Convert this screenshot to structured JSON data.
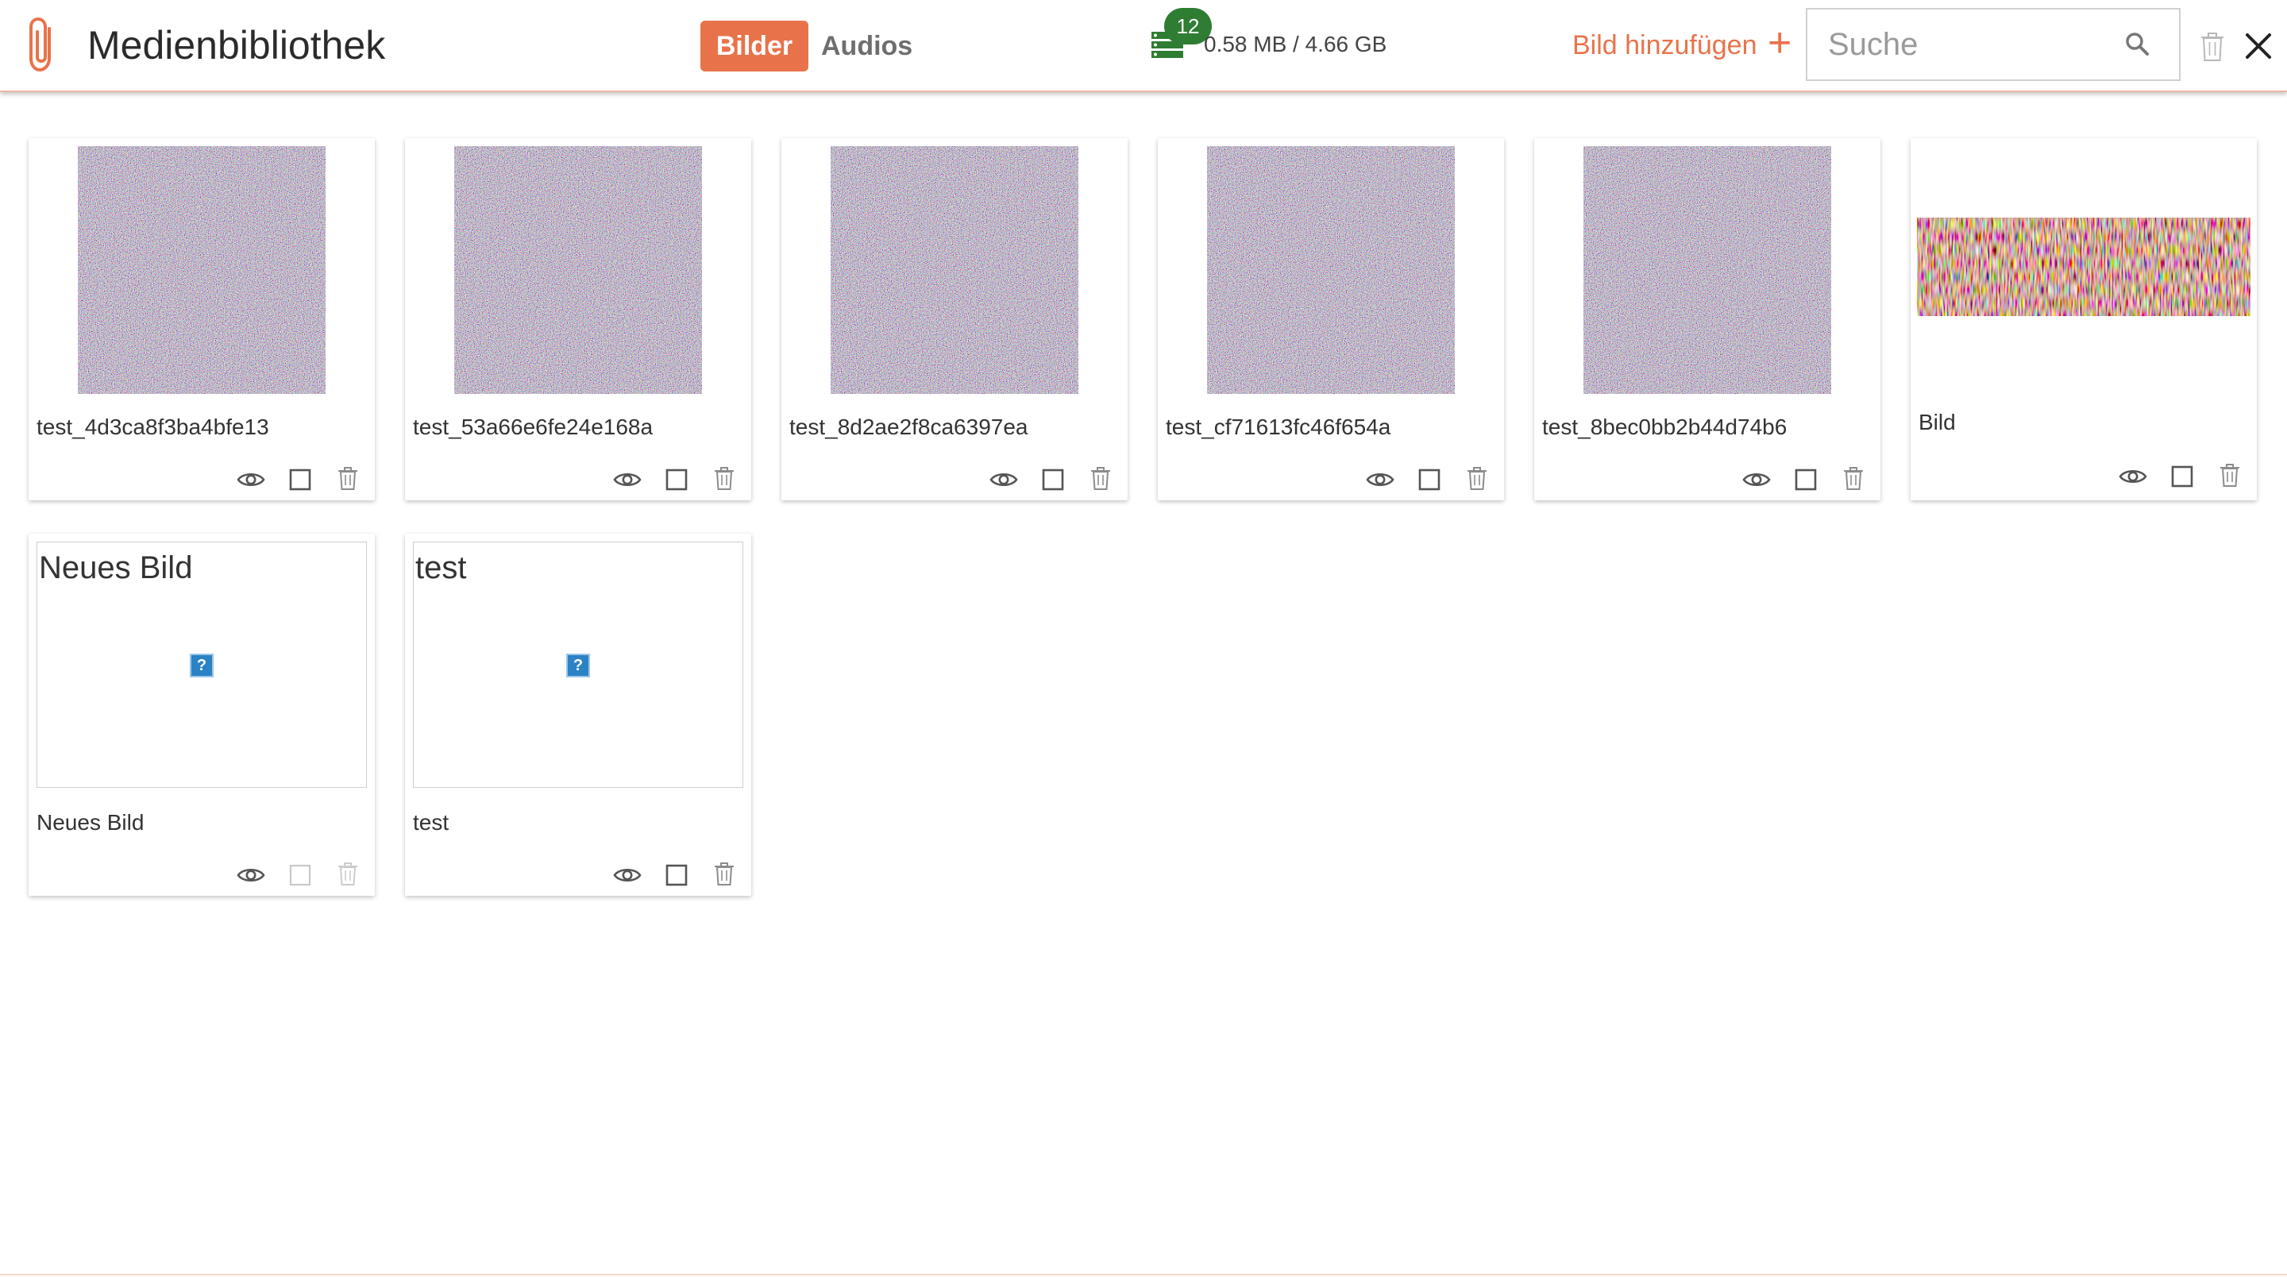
{
  "header": {
    "title": "Medienbibliothek",
    "tabs": [
      {
        "label": "Bilder",
        "active": true
      },
      {
        "label": "Audios",
        "active": false
      }
    ],
    "storage": {
      "count": "12",
      "usage": "0.58 MB / 4.66 GB"
    },
    "add_label": "Bild hinzufügen",
    "add_icon": "+",
    "search": {
      "placeholder": "Suche",
      "value": ""
    },
    "icons": [
      "paperclip-icon",
      "storage-icon",
      "search-icon",
      "trash-icon",
      "close-icon"
    ]
  },
  "colors": {
    "accent": "#e8734a",
    "badge": "#2e7d32",
    "placeholder_icon": "#2b82c5"
  },
  "cards": [
    {
      "label": "test_4d3ca8f3ba4bfe13",
      "thumb": "noise-image"
    },
    {
      "label": "test_53a66e6fe24e168a",
      "thumb": "noise-image"
    },
    {
      "label": "test_8d2ae2f8ca6397ea",
      "thumb": "noise-image"
    },
    {
      "label": "test_cf71613fc46f654a",
      "thumb": "noise-image"
    },
    {
      "label": "test_8bec0bb2b44d74b6",
      "thumb": "noise-image"
    },
    {
      "label": "Bild",
      "thumb": "wide-noise-image"
    },
    {
      "label": "Neues Bild",
      "placeholder_title": "Neues Bild",
      "thumb": "broken-image-icon",
      "actions_disabled": true
    },
    {
      "label": "test",
      "placeholder_title": "test",
      "thumb": "broken-image-icon"
    }
  ]
}
